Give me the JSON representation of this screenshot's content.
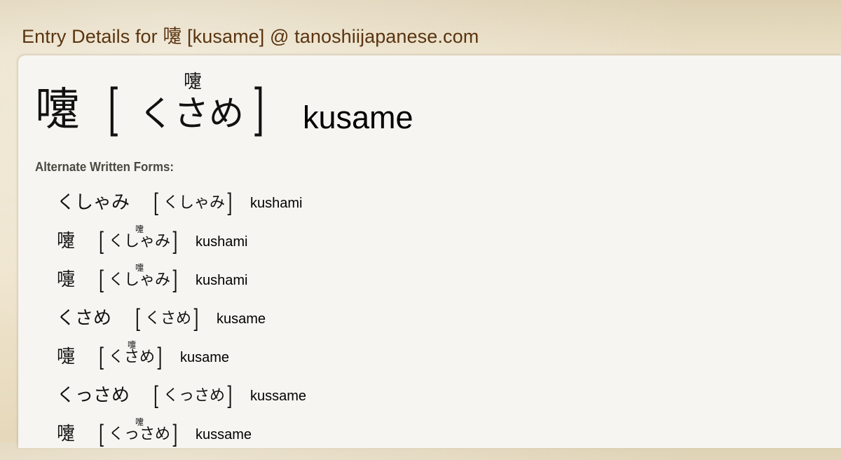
{
  "page": {
    "title": "Entry Details for 嚔 [kusame] @ tanoshiijapanese.com"
  },
  "entry": {
    "written": "嚔",
    "open_bracket": "[",
    "close_bracket": "]",
    "reading": "くさめ",
    "ruby": "嚔",
    "romaji": "kusame"
  },
  "alternates": {
    "heading": "Alternate Written Forms:",
    "items": [
      {
        "written": "くしゃみ",
        "reading": "くしゃみ",
        "ruby": "",
        "romaji": "kushami"
      },
      {
        "written": "嚔",
        "reading": "くしゃみ",
        "ruby": "嚔",
        "romaji": "kushami"
      },
      {
        "written": "嚏",
        "reading": "くしゃみ",
        "ruby": "嚏",
        "romaji": "kushami"
      },
      {
        "written": "くさめ",
        "reading": "くさめ",
        "ruby": "",
        "romaji": "kusame"
      },
      {
        "written": "嚏",
        "reading": "くさめ",
        "ruby": "嚏",
        "romaji": "kusame"
      },
      {
        "written": "くっさめ",
        "reading": "くっさめ",
        "ruby": "",
        "romaji": "kussame"
      },
      {
        "written": "嚔",
        "reading": "くっさめ",
        "ruby": "嚔",
        "romaji": "kussame"
      }
    ]
  }
}
